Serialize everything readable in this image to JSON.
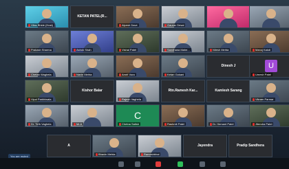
{
  "tiles": [
    {
      "name": "Vilas Bhide (Host)",
      "muted": true
    },
    {
      "name": "KETAN PATEL(R...",
      "center": true
    },
    {
      "name": "Alpesh Dave",
      "muted": true
    },
    {
      "name": "Gaurav Desai",
      "muted": true
    },
    {
      "name": "",
      "muted": false
    },
    {
      "name": "",
      "muted": false
    },
    {
      "name": "Prakash Sharma",
      "muted": true
    },
    {
      "name": "Ashok Shah",
      "muted": true
    },
    {
      "name": "Vishal Patel",
      "muted": true
    },
    {
      "name": "Sandhana Mahe...",
      "muted": true
    },
    {
      "name": "Nilesh Mehta",
      "muted": true
    },
    {
      "name": "Manoj Kakdi",
      "muted": true
    },
    {
      "name": "Chetan Waghela",
      "muted": true
    },
    {
      "name": "Navin Mehta",
      "muted": true
    },
    {
      "name": "Amrit Vora",
      "muted": true
    },
    {
      "name": "Ketan Gokani",
      "muted": true
    },
    {
      "name": "Dinesh J",
      "center": true
    },
    {
      "name": "Umesh Patel",
      "muted": true
    },
    {
      "name": "Vipul Parkhiwala",
      "muted": true
    },
    {
      "name": "Kishor Balar",
      "center": true
    },
    {
      "name": "Rajesh Vaghela",
      "muted": true
    },
    {
      "name": "Rtn.Ramesh Kar...",
      "center": true
    },
    {
      "name": "Kamlesh Sarang",
      "center": true
    },
    {
      "name": "Vikram Parmar",
      "muted": true
    },
    {
      "name": "Dr. Tirth Vaghela",
      "muted": true
    },
    {
      "name": "Mr.A",
      "muted": true
    },
    {
      "name": "Chetna Satish",
      "muted": true
    },
    {
      "name": "Rashmit Patel",
      "muted": true
    },
    {
      "name": "Dr. Hemant Patel",
      "muted": true
    },
    {
      "name": "Jitendra Patel",
      "muted": true
    },
    {
      "name": "A",
      "center": true
    },
    {
      "name": "Bhavin Mehta",
      "muted": true
    },
    {
      "name": "Rameshbhai",
      "muted": true
    },
    {
      "name": "Jayendra",
      "center": true
    },
    {
      "name": "Pradip Sandhera",
      "center": true
    }
  ],
  "letters": {
    "u": "U",
    "c": "C"
  },
  "footer": {
    "mute_badge": "You are muted"
  }
}
